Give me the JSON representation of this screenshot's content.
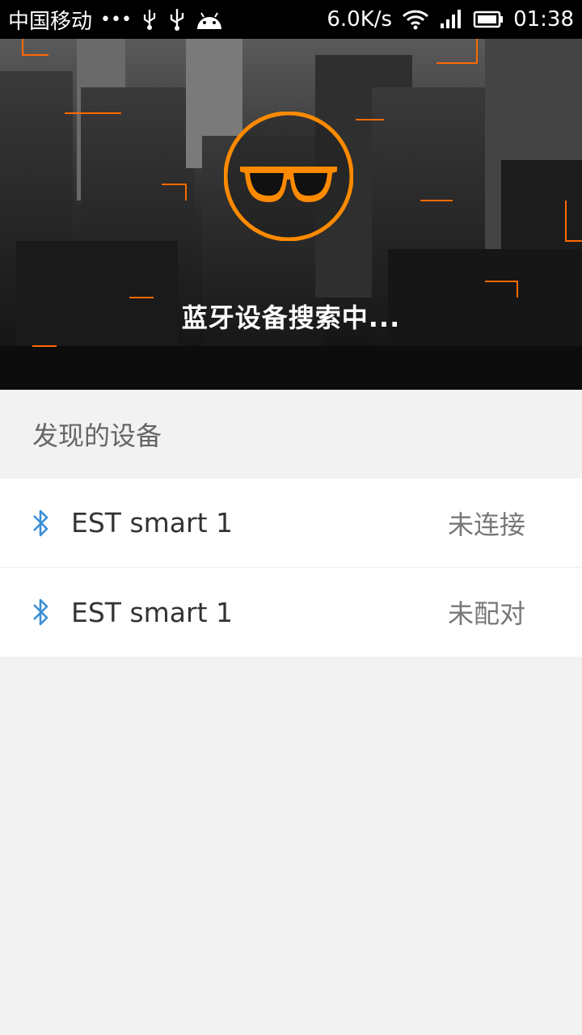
{
  "status_bar": {
    "carrier": "中国移动",
    "dots": "•••",
    "speed": "6.0K/s",
    "time": "01:38",
    "icons": [
      "usb-icon",
      "usb-icon",
      "android-icon",
      "wifi-icon",
      "signal-icon",
      "battery-icon"
    ]
  },
  "hero": {
    "title": "蓝牙设备搜索中...",
    "logo_icon": "sunglasses-icon",
    "accent_color": "#ff8a00"
  },
  "section": {
    "title": "发现的设备"
  },
  "devices": [
    {
      "name": "EST smart 1",
      "status": "未连接",
      "icon": "bluetooth-icon"
    },
    {
      "name": "EST smart 1",
      "status": "未配对",
      "icon": "bluetooth-icon"
    }
  ],
  "colors": {
    "bluetooth": "#3b8fd6",
    "background": "#f2f2f2"
  }
}
